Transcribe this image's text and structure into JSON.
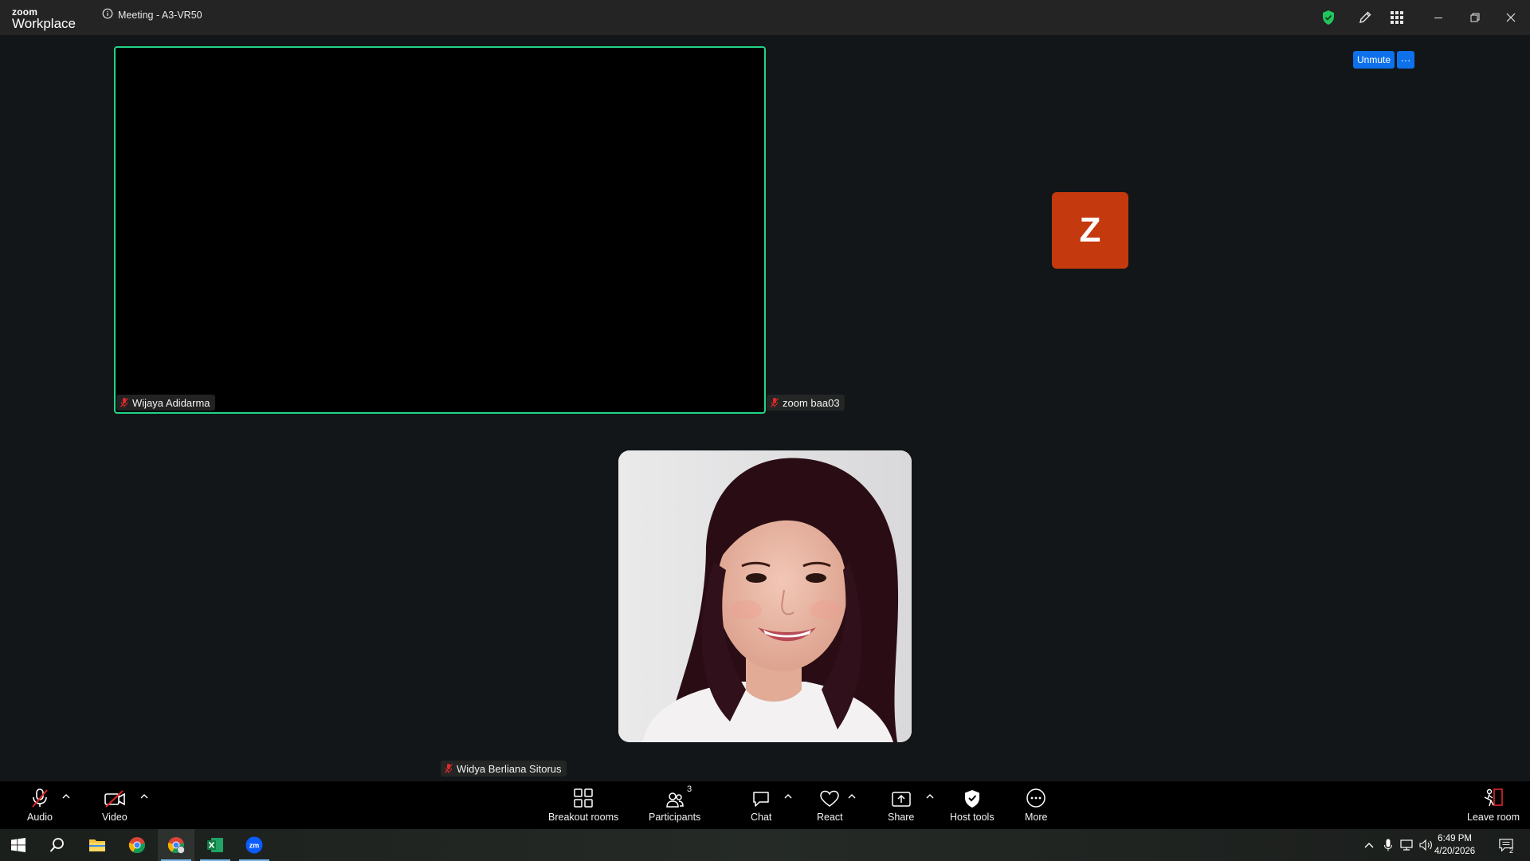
{
  "app": {
    "logo_small": "zoom",
    "logo_big": "Workplace",
    "meeting_title": "Meeting - A3-VR50"
  },
  "stage": {
    "unmute_label": "Unmute",
    "more_options_label": "···",
    "participants": [
      {
        "name": "Wijaya Adidarma",
        "muted": true
      },
      {
        "name": "zoom baa03",
        "muted": true,
        "avatar_initial": "Z",
        "avatar_color": "#c4390e"
      },
      {
        "name": "Widya Berliana Sitorus",
        "muted": true
      }
    ],
    "active_speaker_border_color": "#22d387"
  },
  "toolbar": {
    "audio": "Audio",
    "video": "Video",
    "breakout_rooms": "Breakout rooms",
    "participants": "Participants",
    "participants_count": "3",
    "chat": "Chat",
    "react": "React",
    "share": "Share",
    "host_tools": "Host tools",
    "more": "More",
    "leave_room": "Leave room"
  },
  "taskbar": {
    "time": "6:49 PM",
    "date": "4/20/2026",
    "notification_count": "2",
    "apps": [
      "windows-start",
      "search",
      "file-explorer",
      "chrome",
      "chrome-profile",
      "excel",
      "zoom"
    ]
  },
  "colors": {
    "accent_blue": "#0e71eb",
    "shield_green": "#22c55e",
    "muted_red": "#e02828"
  }
}
